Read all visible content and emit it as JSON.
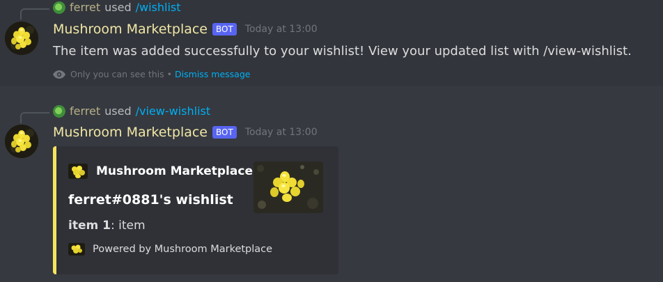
{
  "messages": [
    {
      "reply": {
        "user": "ferret",
        "used": "used",
        "command": "/wishlist"
      },
      "author": "Mushroom Marketplace",
      "bot_tag": "BOT",
      "timestamp": "Today at 13:00",
      "content": "The item was added successfully to your wishlist! View your updated list with /view-wishlist.",
      "ephemeral": {
        "notice": "Only you can see this",
        "separator": "•",
        "dismiss": "Dismiss message"
      }
    },
    {
      "reply": {
        "user": "ferret",
        "used": "used",
        "command": "/view-wishlist"
      },
      "author": "Mushroom Marketplace",
      "bot_tag": "BOT",
      "timestamp": "Today at 13:00",
      "embed": {
        "author": "Mushroom Marketplace",
        "title": "ferret#0881's wishlist",
        "field_name": "item 1",
        "field_sep": ":",
        "field_value": " item",
        "footer": "Powered by Mushroom Marketplace",
        "accent_color": "#f8e45c"
      }
    }
  ],
  "colors": {
    "background": "#36393f",
    "highlight": "#32353b",
    "username": "#f1e7a6",
    "link": "#00aff4",
    "bot_tag": "#5865f2",
    "embed_bg": "#2f3136"
  },
  "icons": {
    "avatar": "mushroom-avatar-icon",
    "eye": "eye-icon"
  }
}
